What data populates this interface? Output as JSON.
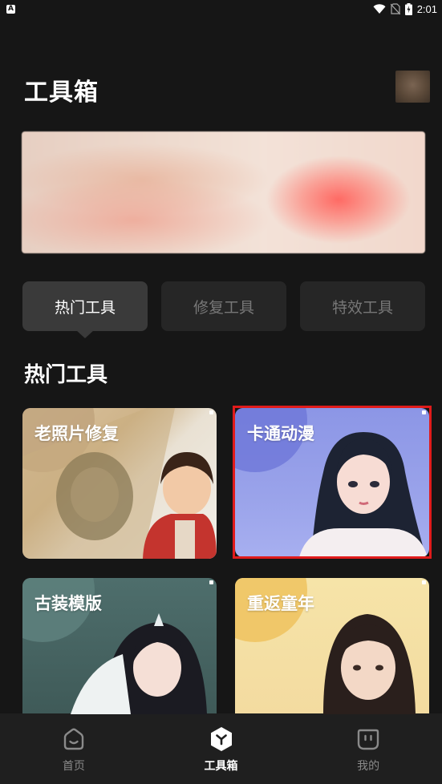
{
  "status_bar": {
    "app_icon_letter": "A",
    "time": "2:01"
  },
  "header": {
    "title": "工具箱"
  },
  "tabs": [
    {
      "label": "热门工具",
      "active": true
    },
    {
      "label": "修复工具",
      "active": false
    },
    {
      "label": "特效工具",
      "active": false
    }
  ],
  "section": {
    "title": "热门工具"
  },
  "cards": [
    {
      "label": "老照片修复"
    },
    {
      "label": "卡通动漫"
    },
    {
      "label": "古装模版"
    },
    {
      "label": "重返童年"
    }
  ],
  "bottom_nav": [
    {
      "label": "首页",
      "icon": "home-face-icon",
      "active": false
    },
    {
      "label": "工具箱",
      "icon": "toolbox-hexagon-icon",
      "active": true
    },
    {
      "label": "我的",
      "icon": "profile-face-icon",
      "active": false
    }
  ],
  "colors": {
    "background": "#161616",
    "highlight": "#e01b1b",
    "tab_active": "#3a3a3a",
    "tab_inactive": "#262626"
  }
}
